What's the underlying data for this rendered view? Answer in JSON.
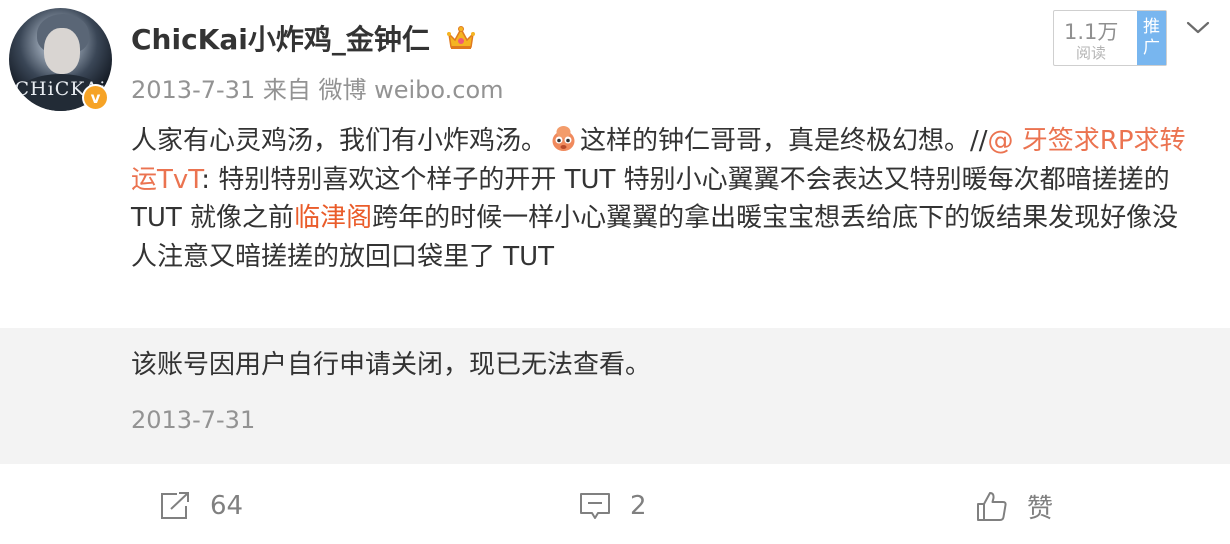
{
  "post": {
    "username": "ChicKai小炸鸡_金钟仁",
    "date": "2013-7-31",
    "source": "来自 微博 weibo.com",
    "views": {
      "count": "1.1万",
      "label": "阅读",
      "promo": "推广"
    },
    "content": {
      "part1": "人家有心灵鸡汤，我们有小炸鸡汤。",
      "part2": "这样的钟仁哥哥，真是终极幻想。//",
      "mention": "@ 牙签求RP求转运TvT",
      "part3": ": 特别特别喜欢这个样子的开开 TUT 特别小心翼翼不会表达又特别暖每次都暗搓搓的 TUT 就像之前",
      "place": "临津阁",
      "part4": "跨年的时候一样小心翼翼的拿出暖宝宝想丢给底下的饭结果发现好像没人注意又暗搓搓的放回口袋里了 TUT"
    }
  },
  "repost": {
    "text": "该账号因用户自行申请关闭，现已无法查看。",
    "date": "2013-7-31"
  },
  "actions": {
    "share_count": "64",
    "comment_count": "2",
    "like_label": "赞"
  },
  "icons": {
    "verified": "verified-badge-icon",
    "crown": "crown-icon",
    "emoji": "emoji-icon",
    "chevron": "chevron-down-icon",
    "share": "share-icon",
    "comment": "comment-icon",
    "like": "like-icon"
  },
  "colors": {
    "accent_link": "#eb7350",
    "verified_badge": "#f6a326",
    "promo_tag": "#78b6ef",
    "muted_text": "#939393"
  },
  "avatar": {
    "text": "CHiCKAi"
  }
}
